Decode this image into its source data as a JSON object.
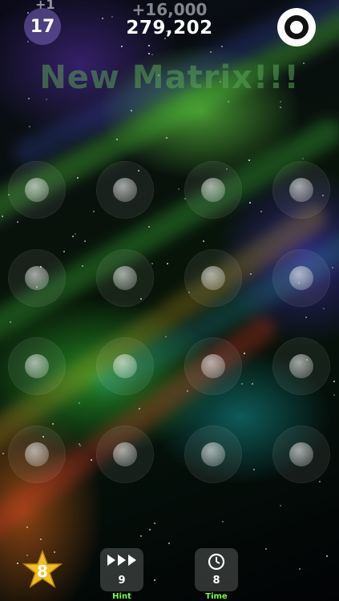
{
  "hud": {
    "level": "17",
    "level_delta": "+1",
    "score_delta": "+16,000",
    "score": "279,202",
    "pause_icon": "pause-ring-icon"
  },
  "banner": {
    "text": "New Matrix!!!"
  },
  "grid": {
    "rows": 4,
    "cols": 4
  },
  "bottom_bar": {
    "star_count": "8",
    "hint": {
      "count": "9",
      "label": "Hint",
      "icon": "fast-forward-icon"
    },
    "time": {
      "count": "8",
      "label": "Time",
      "icon": "clock-icon"
    }
  },
  "colors": {
    "label_green": "#7cff2a",
    "star_gold": "#f0c020"
  }
}
